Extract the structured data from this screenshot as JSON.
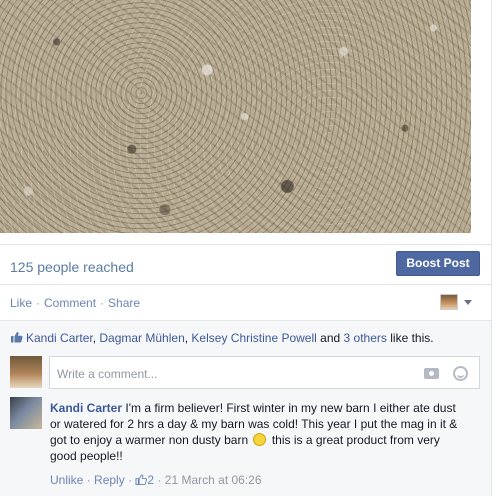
{
  "post": {
    "reach_text": "125 people reached",
    "boost_label": "Boost Post"
  },
  "actions": {
    "like": "Like",
    "comment": "Comment",
    "share": "Share",
    "separator": "·"
  },
  "likes": {
    "names": [
      "Kandi Carter",
      "Dagmar Mühlen",
      "Kelsey Christine Powell"
    ],
    "and_text": "and",
    "others_link": "3 others",
    "suffix": "like this."
  },
  "composer": {
    "placeholder": "Write a comment..."
  },
  "comment": {
    "author": "Kandi Carter",
    "text_before_emoji": "I'm a firm believer! First winter in my new barn I either ate dust or watered for 2 hrs a day & my barn was cold! This year I put the mag in it & got to enjoy a warmer non dusty barn",
    "text_after_emoji": "this is a great product from very good people!!",
    "unlike": "Unlike",
    "reply": "Reply",
    "like_count": "2",
    "timestamp": "21 March at 06:26",
    "separator": "·"
  },
  "icons": {
    "like": "thumbs-up-icon",
    "camera": "camera-icon",
    "emoji": "smiley-icon",
    "caret": "chevron-down-icon"
  },
  "colors": {
    "link": "#3b5998",
    "boost": "#4e69a2",
    "muted": "#9197a3"
  }
}
